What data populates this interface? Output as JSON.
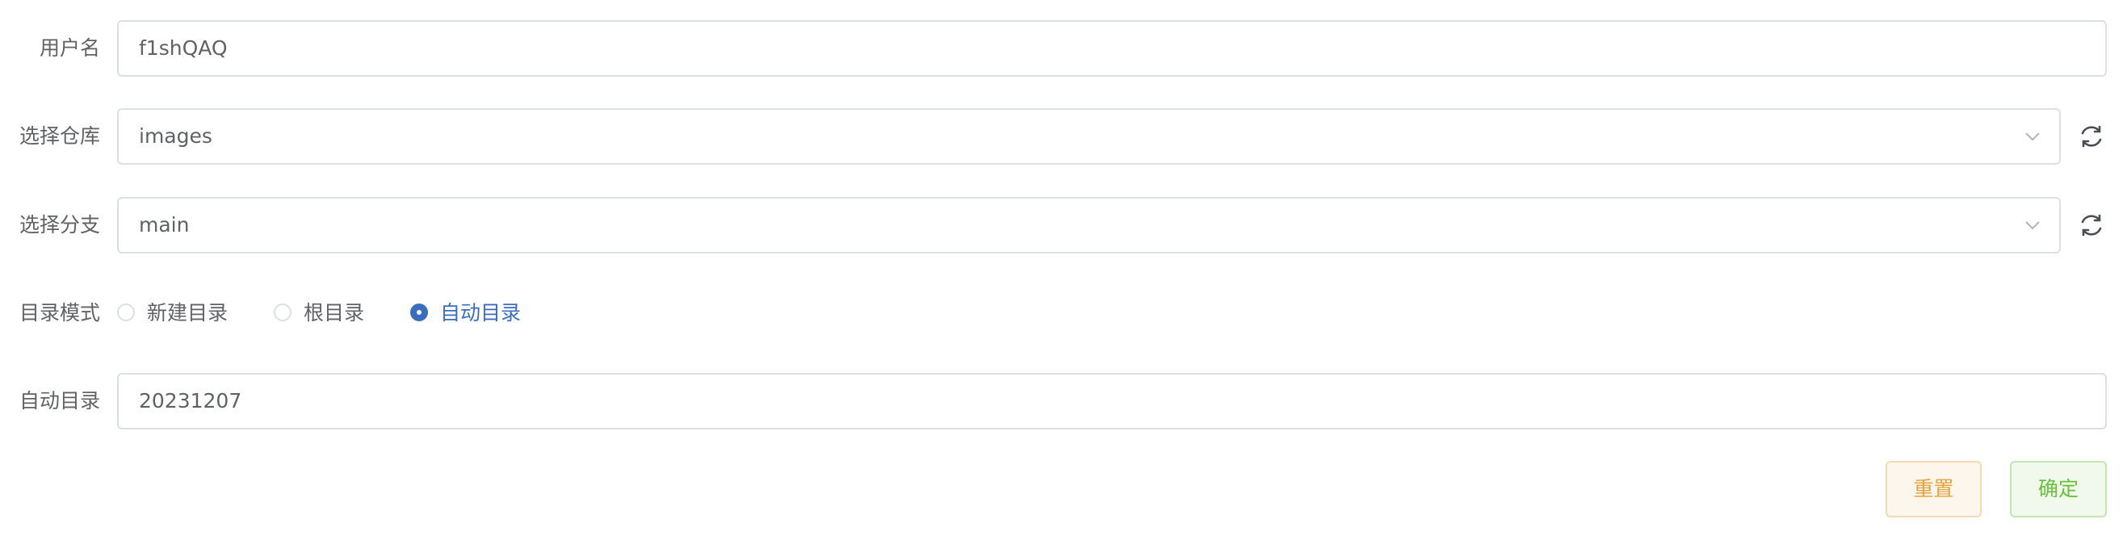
{
  "form": {
    "username": {
      "label": "用户名",
      "value": "f1shQAQ"
    },
    "repository": {
      "label": "选择仓库",
      "value": "images",
      "chevron_icon": "chevron-down-icon",
      "refresh_icon": "refresh-icon"
    },
    "branch": {
      "label": "选择分支",
      "value": "main",
      "chevron_icon": "chevron-down-icon",
      "refresh_icon": "refresh-icon"
    },
    "directory_mode": {
      "label": "目录模式",
      "options": [
        {
          "label": "新建目录",
          "checked": false
        },
        {
          "label": "根目录",
          "checked": false
        },
        {
          "label": "自动目录",
          "checked": true
        }
      ]
    },
    "auto_directory": {
      "label": "自动目录",
      "value": "20231207"
    }
  },
  "actions": {
    "reset_label": "重置",
    "confirm_label": "确定"
  },
  "colors": {
    "primary": "#3a6cc2",
    "warning_text": "#e6a23c",
    "warning_bg": "#fdf6ec",
    "success_text": "#67c23a",
    "success_bg": "#f0f9eb",
    "border": "#dcdfe6",
    "text": "#606266"
  }
}
